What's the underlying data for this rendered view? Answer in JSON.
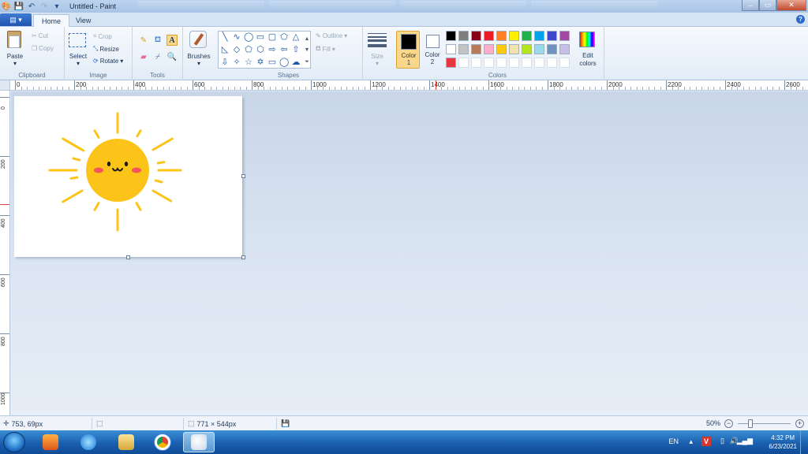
{
  "window": {
    "title": "Untitled - Paint",
    "controls": {
      "minimize": "–",
      "maximize": "▭",
      "close": "✕"
    }
  },
  "tabs": {
    "home": "Home",
    "view": "View",
    "file_symbol": "▤ ▾",
    "help": "?"
  },
  "ribbon": {
    "clipboard": {
      "label": "Clipboard",
      "paste": "Paste",
      "cut": "Cut",
      "copy": "Copy"
    },
    "image": {
      "label": "Image",
      "select": "Select",
      "crop": "Crop",
      "resize": "Resize",
      "rotate": "Rotate"
    },
    "tools": {
      "label": "Tools"
    },
    "brushes": {
      "label": "Brushes"
    },
    "shapes": {
      "label": "Shapes",
      "outline": "Outline",
      "fill": "Fill"
    },
    "size": {
      "label": "Size"
    },
    "colors": {
      "label": "Colors",
      "color1": "Color",
      "color1_num": "1",
      "color2": "Color",
      "color2_num": "2",
      "edit": "Edit",
      "edit2": "colors",
      "color1_value": "#000000",
      "color2_value": "#ffffff",
      "palette_row1": [
        "#000000",
        "#7f7f7f",
        "#880015",
        "#ed1c24",
        "#ff7f27",
        "#fff200",
        "#22b14c",
        "#00a2e8",
        "#3f48cc",
        "#a349a4"
      ],
      "palette_row2": [
        "#ffffff",
        "#c3c3c3",
        "#b97a57",
        "#ffaec9",
        "#ffc90e",
        "#efe4b0",
        "#b5e61d",
        "#99d9ea",
        "#7092be",
        "#c8bfe7"
      ],
      "palette_row3": [
        "#e8353f",
        "",
        "",
        "",
        "",
        "",
        "",
        "",
        "",
        ""
      ]
    }
  },
  "ruler": {
    "h_labels": [
      "0",
      "200",
      "400",
      "600",
      "800",
      "1000",
      "1200",
      "1400",
      "1600",
      "1800",
      "2000",
      "2200",
      "2400",
      "2600"
    ],
    "v_labels": [
      "0",
      "200",
      "400",
      "600",
      "800",
      "1000"
    ]
  },
  "status": {
    "cursor": "753, 69px",
    "size": "771 × 544px",
    "zoom": "50%"
  },
  "taskbar": {
    "lang": "EN",
    "time": "4:32 PM",
    "date": "6/23/2021",
    "apps": [
      "windows-media-player",
      "internet-explorer",
      "file-explorer",
      "chrome",
      "paint"
    ]
  },
  "drawing": {
    "sun_color": "#fcc419",
    "ray_color": "#fcc419",
    "cheek_color": "#f2555a"
  }
}
